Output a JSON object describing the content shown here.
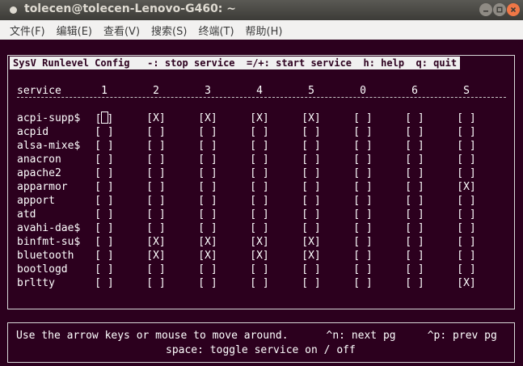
{
  "window": {
    "title": "tolecen@tolecen-Lenovo-G460: ~"
  },
  "menu": [
    {
      "label": "文件(F)"
    },
    {
      "label": "编辑(E)"
    },
    {
      "label": "查看(V)"
    },
    {
      "label": "搜索(S)"
    },
    {
      "label": "终端(T)"
    },
    {
      "label": "帮助(H)"
    }
  ],
  "panel": {
    "title": "SysV Runlevel Config   -: stop service  =/+: start service  h: help  q: quit"
  },
  "table": {
    "service_header": "service",
    "runlevels": [
      "1",
      "2",
      "3",
      "4",
      "5",
      "0",
      "6",
      "S"
    ],
    "rows": [
      {
        "name": "acpi-supp$",
        "cells": [
          "[ ]",
          "[X]",
          "[X]",
          "[X]",
          "[X]",
          "[ ]",
          "[ ]",
          "[ ]"
        ]
      },
      {
        "name": "acpid",
        "cells": [
          "[ ]",
          "[ ]",
          "[ ]",
          "[ ]",
          "[ ]",
          "[ ]",
          "[ ]",
          "[ ]"
        ]
      },
      {
        "name": "alsa-mixe$",
        "cells": [
          "[ ]",
          "[ ]",
          "[ ]",
          "[ ]",
          "[ ]",
          "[ ]",
          "[ ]",
          "[ ]"
        ]
      },
      {
        "name": "anacron",
        "cells": [
          "[ ]",
          "[ ]",
          "[ ]",
          "[ ]",
          "[ ]",
          "[ ]",
          "[ ]",
          "[ ]"
        ]
      },
      {
        "name": "apache2",
        "cells": [
          "[ ]",
          "[ ]",
          "[ ]",
          "[ ]",
          "[ ]",
          "[ ]",
          "[ ]",
          "[ ]"
        ]
      },
      {
        "name": "apparmor",
        "cells": [
          "[ ]",
          "[ ]",
          "[ ]",
          "[ ]",
          "[ ]",
          "[ ]",
          "[ ]",
          "[X]"
        ]
      },
      {
        "name": "apport",
        "cells": [
          "[ ]",
          "[ ]",
          "[ ]",
          "[ ]",
          "[ ]",
          "[ ]",
          "[ ]",
          "[ ]"
        ]
      },
      {
        "name": "atd",
        "cells": [
          "[ ]",
          "[ ]",
          "[ ]",
          "[ ]",
          "[ ]",
          "[ ]",
          "[ ]",
          "[ ]"
        ]
      },
      {
        "name": "avahi-dae$",
        "cells": [
          "[ ]",
          "[ ]",
          "[ ]",
          "[ ]",
          "[ ]",
          "[ ]",
          "[ ]",
          "[ ]"
        ]
      },
      {
        "name": "binfmt-su$",
        "cells": [
          "[ ]",
          "[X]",
          "[X]",
          "[X]",
          "[X]",
          "[ ]",
          "[ ]",
          "[ ]"
        ]
      },
      {
        "name": "bluetooth",
        "cells": [
          "[ ]",
          "[X]",
          "[X]",
          "[X]",
          "[X]",
          "[ ]",
          "[ ]",
          "[ ]"
        ]
      },
      {
        "name": "bootlogd",
        "cells": [
          "[ ]",
          "[ ]",
          "[ ]",
          "[ ]",
          "[ ]",
          "[ ]",
          "[ ]",
          "[ ]"
        ]
      },
      {
        "name": "brltty",
        "cells": [
          "[ ]",
          "[ ]",
          "[ ]",
          "[ ]",
          "[ ]",
          "[ ]",
          "[ ]",
          "[X]"
        ]
      }
    ]
  },
  "footer": {
    "line1": "Use the arrow keys or mouse to move around.      ^n: next pg     ^p: prev pg",
    "line2": "space: toggle service on / off"
  },
  "colors": {
    "terminal_bg": "#2c001e",
    "close_button": "#f07746"
  }
}
